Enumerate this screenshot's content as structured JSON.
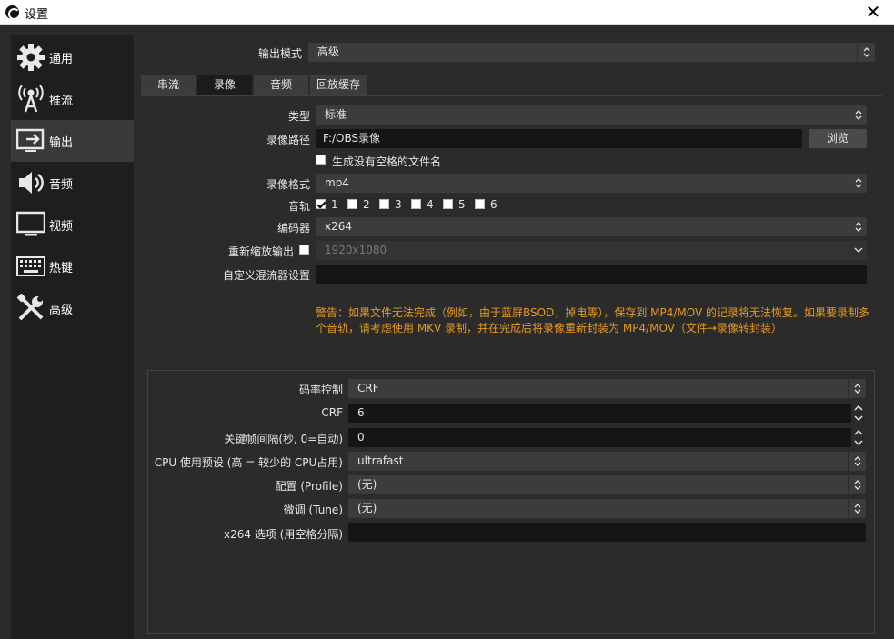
{
  "window": {
    "title": "设置"
  },
  "sidebar": {
    "items": [
      {
        "label": "通用",
        "icon": "gear-icon"
      },
      {
        "label": "推流",
        "icon": "broadcast-icon"
      },
      {
        "label": "输出",
        "icon": "output-icon"
      },
      {
        "label": "音频",
        "icon": "speaker-icon"
      },
      {
        "label": "视频",
        "icon": "monitor-icon"
      },
      {
        "label": "热键",
        "icon": "keyboard-icon"
      },
      {
        "label": "高级",
        "icon": "tools-icon"
      }
    ],
    "active": "输出"
  },
  "output": {
    "mode_label": "输出模式",
    "mode_value": "高级",
    "tabs": [
      "串流",
      "录像",
      "音频",
      "回放缓存"
    ],
    "active_tab": "录像",
    "type_label": "类型",
    "type_value": "标准",
    "path_label": "录像路径",
    "path_value": "F:/OBS录像",
    "browse_label": "浏览",
    "nospace_label": "生成没有空格的文件名",
    "format_label": "录像格式",
    "format_value": "mp4",
    "tracks_label": "音轨",
    "tracks": [
      "1",
      "2",
      "3",
      "4",
      "5",
      "6"
    ],
    "encoder_label": "编码器",
    "encoder_value": "x264",
    "rescale_label": "重新缩放输出",
    "rescale_value": "1920x1080",
    "mux_label": "自定义混流器设置",
    "mux_value": "",
    "warning": "警告：如果文件无法完成（例如，由于蓝屏BSOD，掉电等），保存到 MP4/MOV 的记录将无法恢复。如果要录制多个音轨，请考虑使用 MKV 录制，并在完成后将录像重新封装为 MP4/MOV（文件→录像转封装）"
  },
  "encoder_settings": {
    "rate_control_label": "码率控制",
    "rate_control_value": "CRF",
    "crf_label": "CRF",
    "crf_value": "6",
    "keyframe_label": "关键帧间隔(秒, 0=自动)",
    "keyframe_value": "0",
    "preset_label": "CPU 使用预设 (高 = 较少的 CPU占用)",
    "preset_value": "ultrafast",
    "profile_label": "配置 (Profile)",
    "profile_value": "(无)",
    "tune_label": "微调 (Tune)",
    "tune_value": "(无)",
    "options_label": "x264 选项 (用空格分隔)",
    "options_value": ""
  },
  "colors": {
    "warning": "#e89a1c",
    "background": "#2b2b2b",
    "sidebar": "#1e1e1e"
  }
}
